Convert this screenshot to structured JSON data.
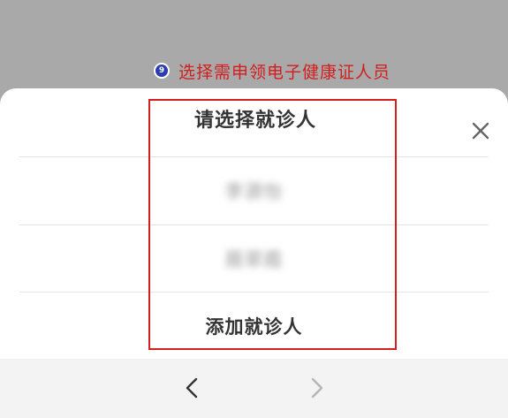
{
  "annotation": {
    "step_number": "9",
    "step_text": "选择需申领电子健康证人员",
    "highlight_color": "#d41f1f"
  },
  "sheet": {
    "title": "请选择就诊人",
    "close_icon": "close-icon",
    "options": [
      {
        "label": "李源怡",
        "blurred": true
      },
      {
        "label": "聂翠霞",
        "blurred": true
      },
      {
        "label": "添加就诊人",
        "blurred": false
      }
    ]
  },
  "nav": {
    "back_icon": "chevron-left-icon",
    "forward_icon": "chevron-right-icon",
    "forward_enabled": false
  }
}
